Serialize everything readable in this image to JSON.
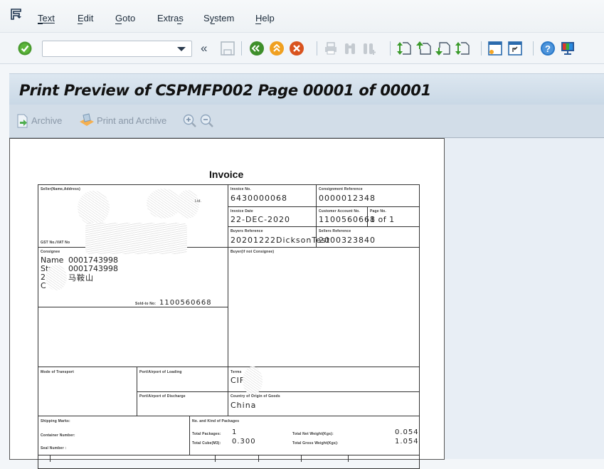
{
  "menubar": {
    "items": [
      {
        "label": "Text",
        "mnemonic": "T"
      },
      {
        "label": "Edit",
        "mnemonic": "E"
      },
      {
        "label": "Goto",
        "mnemonic": "G"
      },
      {
        "label": "Extras",
        "mnemonic": "a"
      },
      {
        "label": "System",
        "mnemonic": "y"
      },
      {
        "label": "Help",
        "mnemonic": "H"
      }
    ],
    "text_label": "Text",
    "edit_label": "Edit",
    "goto_label": "Goto",
    "extras_label": "Extras",
    "system_label": "System",
    "help_label": "Help"
  },
  "toolbar": {
    "command_field_value": "",
    "collapse_glyph": "«",
    "icons": [
      "enter-icon",
      "save-icon",
      "back-icon",
      "exit-icon",
      "cancel-icon",
      "print-icon",
      "find-icon",
      "find-next-icon",
      "first-page-icon",
      "previous-page-icon",
      "next-page-icon",
      "last-page-icon",
      "new-session-icon",
      "shortcut-icon",
      "help-icon",
      "layout-icon"
    ]
  },
  "title": {
    "text": "Print Preview of CSPMFP002 Page 00001 of 00001"
  },
  "app_toolbar": {
    "archive_label": "Archive",
    "print_archive_label": "Print and Archive"
  },
  "invoice": {
    "title": "Invoice",
    "seller_label": "Seller(Name,Address)",
    "seller_suffix": "Ltd.",
    "gst_label": "GST  No./VAT  No",
    "invoice_no_label": "Invoice  No.",
    "invoice_no": "6430000068",
    "consignment_ref_label": "Consignment  Reference",
    "consignment_ref": "0000012348",
    "invoice_date_label": "Invoice  Date",
    "invoice_date": "22-DEC-2020",
    "customer_account_label": "Customer  Account  No.",
    "customer_account": "1100560668",
    "page_no_label": "Page  No.",
    "page_no": "1  of 1",
    "buyers_ref_label": "Buyers  Reference",
    "buyers_ref": "20201222DicksonTest",
    "sellers_ref_label": "Sellers  Reference",
    "sellers_ref": "2000323840",
    "consignee_label": "Consignee",
    "consignee_name_key": "Name",
    "consignee_name": "0001743998",
    "consignee_street_key": "Str",
    "consignee_street": "0001743998",
    "consignee_city_key": "2",
    "consignee_city": "马鞍山",
    "consignee_country_key": "C",
    "sold_to_label": "Sold-to  No:",
    "sold_to": "1100560668",
    "buyer_label": "Buyer(if  not  Consignee)",
    "mode_transport_label": "Mode  of  Transport",
    "port_loading_label": "Port/Airport  of  Loading",
    "port_discharge_label": "Port/Airport  of  Discharge",
    "terms_label": "Terms",
    "terms_value": "CIF",
    "country_origin_label": "Country  of  Origin  of  Goods",
    "country_origin": "China",
    "shipping_marks_label": "Shipping  Marks:",
    "container_label": "Container  Number:",
    "seal_label": "Seal  Number :",
    "packages_kind_label": "No.  and  Kind  of  Packages",
    "total_packages_label": "Total  Packages:",
    "total_packages": "1",
    "total_cube_label": "Total  Cube(M3):",
    "total_cube": "0.300",
    "net_weight_label": "Total  Net  Weight(Kgs):",
    "net_weight": "0.054",
    "gross_weight_label": "Total  Gross  Weight(Kgs):",
    "gross_weight": "1.054"
  }
}
